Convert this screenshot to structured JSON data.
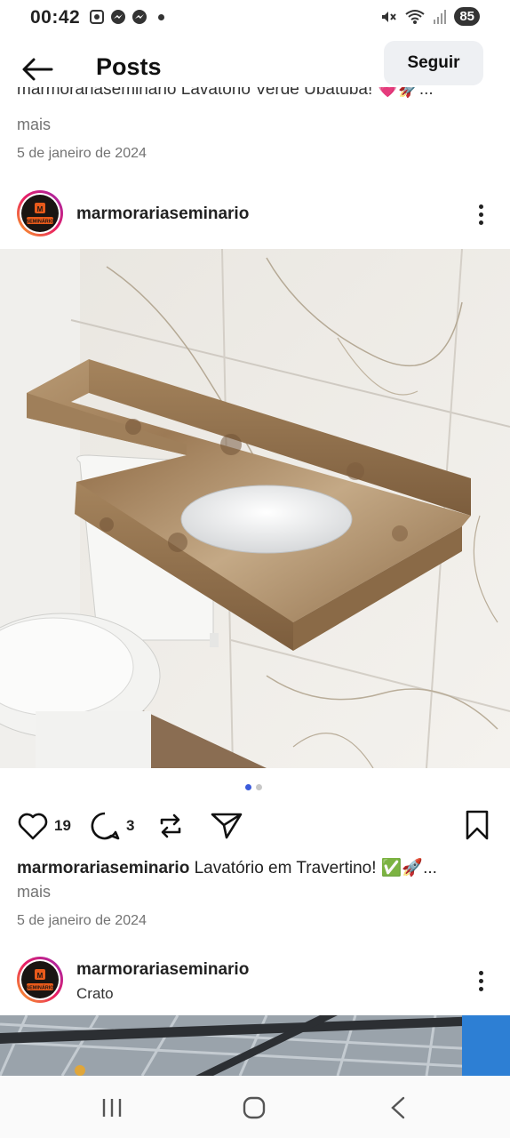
{
  "status_bar": {
    "time": "00:42",
    "battery": "85"
  },
  "header": {
    "title": "Posts",
    "follow_label": "Seguir"
  },
  "prev_post": {
    "caption_cut": "marmorariaseminario Lavatório Verde Ubatuba! 💗🚀...",
    "more": "mais",
    "date": "5 de janeiro de 2024"
  },
  "post": {
    "username": "marmorariaseminario",
    "avatar_text": "SEMINÁRIO",
    "likes": "19",
    "comments": "3",
    "caption_user": "marmorariaseminario",
    "caption_text": " Lavatório em Travertino! ✅🚀...",
    "more": "mais",
    "date": "5 de janeiro de 2024",
    "carousel_active_color": "#3b5bdb"
  },
  "next_post": {
    "username": "marmorariaseminario",
    "location": "Crato"
  }
}
